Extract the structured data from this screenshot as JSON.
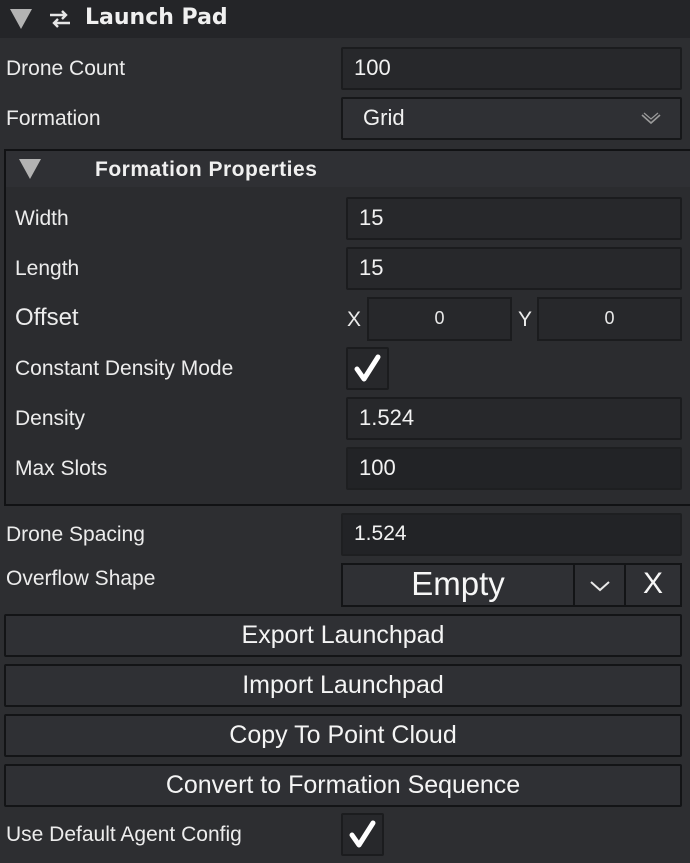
{
  "header": {
    "title": "Launch Pad",
    "expanded": true,
    "icon": "swap-arrows-icon"
  },
  "fields": {
    "drone_count": {
      "label": "Drone Count",
      "value": "100"
    },
    "formation": {
      "label": "Formation",
      "value": "Grid"
    }
  },
  "formation_properties": {
    "title": "Formation Properties",
    "expanded": true,
    "width": {
      "label": "Width",
      "value": "15"
    },
    "length": {
      "label": "Length",
      "value": "15"
    },
    "offset": {
      "label": "Offset",
      "x_label": "X",
      "x_value": "0",
      "y_label": "Y",
      "y_value": "0"
    },
    "constant_density": {
      "label": "Constant Density Mode",
      "checked": true
    },
    "density": {
      "label": "Density",
      "value": "1.524"
    },
    "max_slots": {
      "label": "Max Slots",
      "value": "100"
    }
  },
  "drone_spacing": {
    "label": "Drone Spacing",
    "value": "1.524"
  },
  "overflow_shape": {
    "label": "Overflow Shape",
    "value": "Empty",
    "clear_label": "X"
  },
  "buttons": {
    "export": "Export Launchpad",
    "import": "Import Launchpad",
    "copy": "Copy To Point Cloud",
    "convert": "Convert to Formation Sequence"
  },
  "default_agent": {
    "label": "Use Default Agent Config",
    "checked": true
  }
}
